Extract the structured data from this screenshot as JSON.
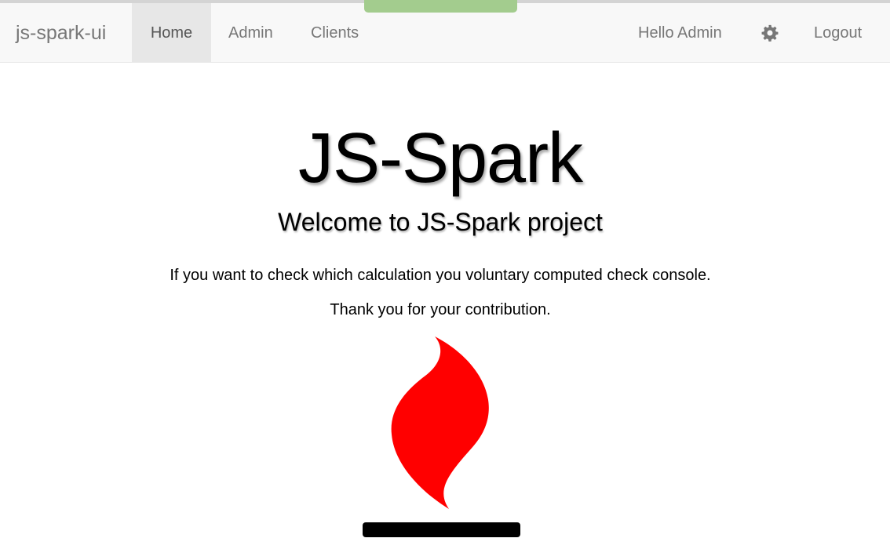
{
  "navbar": {
    "brand": "js-spark-ui",
    "items": [
      {
        "label": "Home",
        "active": true
      },
      {
        "label": "Admin",
        "active": false
      },
      {
        "label": "Clients",
        "active": false
      }
    ],
    "greeting": "Hello Admin",
    "settings_icon": "gear-icon",
    "logout_label": "Logout"
  },
  "hero": {
    "title": "JS-Spark",
    "subtitle": "Welcome to JS-Spark project",
    "text_1": "If you want to check which calculation you voluntary computed check console.",
    "text_2": "Thank you for your contribution.",
    "logo_icon": "flame-icon"
  },
  "colors": {
    "navbar_bg": "#f8f8f8",
    "active_tab_bg": "#e7e7e7",
    "nav_text": "#777777",
    "loading_bar": "#a3cc8e",
    "flame": "#ff0000",
    "flame_base": "#000000"
  }
}
